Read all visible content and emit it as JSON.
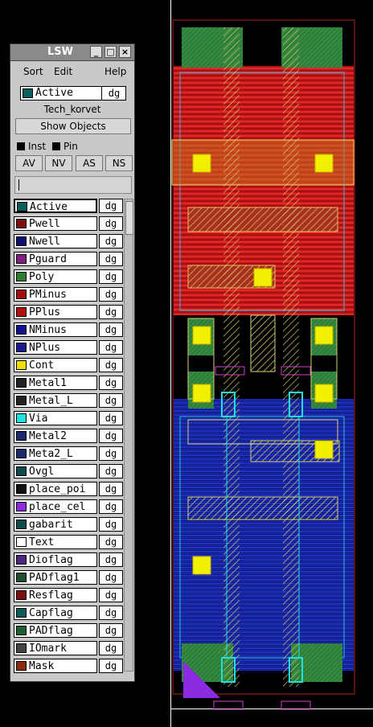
{
  "window": {
    "title": "LSW"
  },
  "menu": {
    "sort": "Sort",
    "edit": "Edit",
    "help": "Help"
  },
  "current_layer": {
    "name": "Active",
    "purpose": "dg"
  },
  "tech_library": "Tech_korvet",
  "show_objects_label": "Show Objects",
  "checkboxes": {
    "inst": "Inst",
    "pin": "Pin"
  },
  "view_buttons": [
    "AV",
    "NV",
    "AS",
    "NS"
  ],
  "layers": [
    {
      "name": "Active",
      "purpose": "dg",
      "icon": "active-icon",
      "color": "#0b5f5f"
    },
    {
      "name": "Pwell",
      "purpose": "dg",
      "icon": "pwell-icon",
      "color": "#7a1010"
    },
    {
      "name": "Nwell",
      "purpose": "dg",
      "icon": "nwell-icon",
      "color": "#101070"
    },
    {
      "name": "Pguard",
      "purpose": "dg",
      "icon": "pguard-icon",
      "color": "#802080"
    },
    {
      "name": "Poly",
      "purpose": "dg",
      "icon": "poly-icon",
      "color": "#2e7d32"
    },
    {
      "name": "PMinus",
      "purpose": "dg",
      "icon": "pminus-icon",
      "color": "#a01010"
    },
    {
      "name": "PPlus",
      "purpose": "dg",
      "icon": "pplus-icon",
      "color": "#b01010"
    },
    {
      "name": "NMinus",
      "purpose": "dg",
      "icon": "nminus-icon",
      "color": "#101090"
    },
    {
      "name": "NPlus",
      "purpose": "dg",
      "icon": "nplus-icon",
      "color": "#1a1a90"
    },
    {
      "name": "Cont",
      "purpose": "dg",
      "icon": "cont-icon",
      "color": "#f0e000"
    },
    {
      "name": "Metal1",
      "purpose": "dg",
      "icon": "metal1-icon",
      "color": "#222222"
    },
    {
      "name": "Metal_L",
      "purpose": "dg",
      "icon": "metal-l-icon",
      "color": "#222222"
    },
    {
      "name": "Via",
      "purpose": "dg",
      "icon": "via-icon",
      "color": "#20e0e0"
    },
    {
      "name": "Metal2",
      "purpose": "dg",
      "icon": "metal2-icon",
      "color": "#1a2a6a"
    },
    {
      "name": "Meta2_L",
      "purpose": "dg",
      "icon": "meta2-l-icon",
      "color": "#1a2a6a"
    },
    {
      "name": "Ovgl",
      "purpose": "dg",
      "icon": "ovgl-icon",
      "color": "#0c4c4c"
    },
    {
      "name": "place_poi",
      "purpose": "dg",
      "icon": "place-poi-icon",
      "color": "#111111"
    },
    {
      "name": "place_cel",
      "purpose": "dg",
      "icon": "place-cel-icon",
      "color": "#8a2be2"
    },
    {
      "name": "gabarit",
      "purpose": "dg",
      "icon": "gabarit-icon",
      "color": "#0c4c4c"
    },
    {
      "name": "Text",
      "purpose": "dg",
      "icon": "text-icon",
      "color": "#ffffff"
    },
    {
      "name": "Dioflag",
      "purpose": "dg",
      "icon": "dioflag-icon",
      "color": "#4a2a7a"
    },
    {
      "name": "PADflag1",
      "purpose": "dg",
      "icon": "padflag1-icon",
      "color": "#1f4f2f"
    },
    {
      "name": "Resflag",
      "purpose": "dg",
      "icon": "resflag-icon",
      "color": "#7a1010"
    },
    {
      "name": "Capflag",
      "purpose": "dg",
      "icon": "capflag-icon",
      "color": "#0c5c5c"
    },
    {
      "name": "PADflag",
      "purpose": "dg",
      "icon": "padflag-icon",
      "color": "#1f5f2f"
    },
    {
      "name": "IOmark",
      "purpose": "dg",
      "icon": "iomark-icon",
      "color": "#444444"
    },
    {
      "name": "Mask",
      "purpose": "dg",
      "icon": "mask-icon",
      "color": "#8a2a10"
    }
  ],
  "layout_canvas": {
    "background": "#000000",
    "colors": {
      "pwell": "#e02020",
      "nwell": "#2030e0",
      "active": "#2e8b3e",
      "poly": "#d8d080",
      "cont": "#f0f000",
      "via": "#20e0e0",
      "boundary": "#c02020",
      "place_cel": "#8a2be2",
      "metal2": "#20c0e0"
    }
  }
}
